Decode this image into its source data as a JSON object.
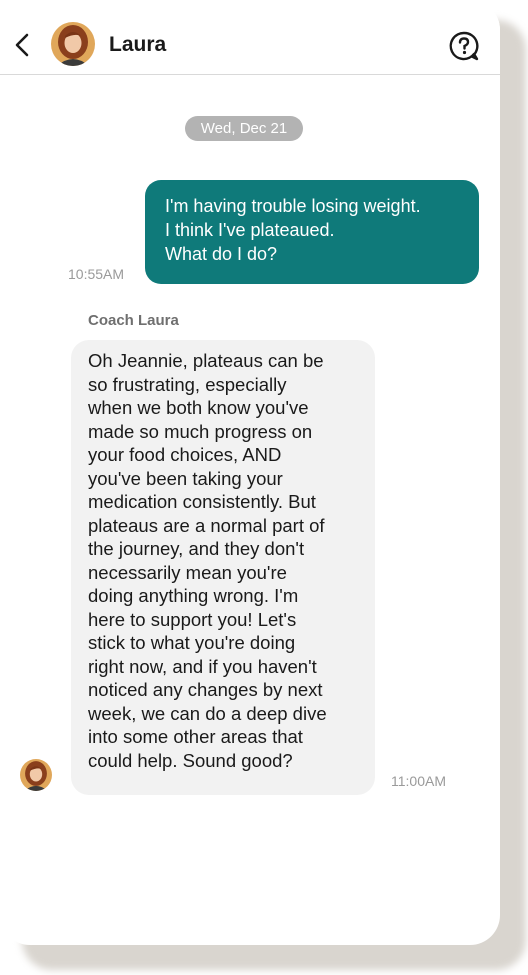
{
  "header": {
    "contact_name": "Laura",
    "back_icon": "back-arrow-icon",
    "help_icon": "help-chat-icon"
  },
  "conversation": {
    "date_divider": "Wed, Dec 21",
    "outgoing_message": {
      "lines": [
        "I'm having trouble losing weight.",
        "I think I've plateaued.",
        "What do I do?"
      ],
      "time": "10:55AM"
    },
    "incoming_message": {
      "sender": "Coach Laura",
      "lines": [
        "Oh Jeannie, plateaus can be",
        "so frustrating, especially",
        "when we both know you've",
        "made so much progress on",
        "your food choices, AND",
        "you've been taking your",
        "medication consistently. But",
        "plateaus are a normal part of",
        "the journey, and they don't",
        "necessarily mean you're",
        "doing anything wrong. I'm",
        "here to support you! Let's",
        "stick to what you're doing",
        "right now, and if you haven't",
        "noticed any changes by next",
        "week, we can do a deep dive",
        "into some other areas that",
        "could help. Sound good?"
      ],
      "time": "11:00AM"
    }
  },
  "colors": {
    "outgoing_bubble": "#0f7a7a",
    "incoming_bubble": "#f2f2f2",
    "date_pill": "#b3b3b3"
  }
}
